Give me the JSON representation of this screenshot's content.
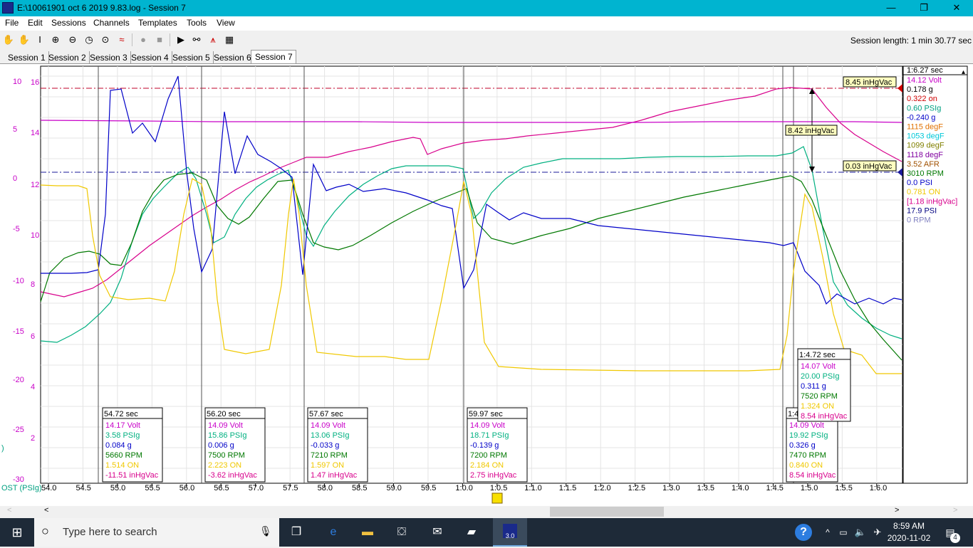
{
  "window": {
    "title": "E:\\10061901 oct 6 2019 9.83.log - Session 7",
    "minimize": "—",
    "restore": "❐",
    "close": "✕"
  },
  "menu": [
    "File",
    "Edit",
    "Sessions",
    "Channels",
    "Templates",
    "Tools",
    "View"
  ],
  "session_length": "Session length:  1 min 30.77 sec",
  "tabs": [
    "Session 1",
    "Session 2",
    "Session 3",
    "Session 4",
    "Session 5",
    "Session 6",
    "Session 7"
  ],
  "active_tab": "Session 7",
  "colors": {
    "volt": "#c800c8",
    "psi_green": "#00b080",
    "g_blue": "#0000c8",
    "rpm_green": "#007800",
    "on_yellow": "#f0c800",
    "vac_magenta": "#d8008c",
    "red": "#d00000",
    "cyan": "#00c8d8",
    "olive": "#808000",
    "purple": "#8000a0",
    "brown": "#a05000",
    "grey": "#8080c0",
    "navy": "#000080"
  },
  "left_axes": {
    "outer_ticks": [
      "10",
      "5",
      "0",
      "-5",
      "-10",
      "-15",
      "-20",
      "-25",
      "-30"
    ],
    "inner_ticks": [
      "16",
      "14",
      "12",
      "10",
      "8",
      "6",
      "4",
      "2"
    ],
    "bottom_label": "OST (PSIg)",
    "partial_label": ")"
  },
  "x_ticks": [
    "54.0",
    "54.5",
    "55.0",
    "55.5",
    "56.0",
    "56.5",
    "57.0",
    "57.5",
    "58.0",
    "58.5",
    "59.0",
    "59.5",
    "1:0.0",
    "1:0.5",
    "1:1.0",
    "1:1.5",
    "1:2.0",
    "1:2.5",
    "1:3.0",
    "1:3.5",
    "1:4.0",
    "1:4.5",
    "1:5.0",
    "1:5.5",
    "1:6.0"
  ],
  "right_panel": {
    "time": "1:6.27 sec",
    "values": [
      {
        "text": "14.12 Volt",
        "color": "#c800c8"
      },
      {
        "text": "0.178 g",
        "color": "#000000"
      },
      {
        "text": "0.322 on",
        "color": "#d00000"
      },
      {
        "text": "0.60 PSIg",
        "color": "#00a080"
      },
      {
        "text": "-0.240 g",
        "color": "#0000c8"
      },
      {
        "text": "1115 degF",
        "color": "#e07000"
      },
      {
        "text": "1053 degF",
        "color": "#00c8d8"
      },
      {
        "text": "1099 degF",
        "color": "#808000"
      },
      {
        "text": "1118 degF",
        "color": "#8000a0"
      },
      {
        "text": "3.52 AFR",
        "color": "#a05000"
      },
      {
        "text": "3010 RPM",
        "color": "#007800"
      },
      {
        "text": "0.0 PSI",
        "color": "#0000c8"
      },
      {
        "text": "0.781 ON",
        "color": "#f0c800"
      },
      {
        "text": "[1.18 inHgVac]",
        "color": "#d8008c"
      },
      {
        "text": "17.9 PSI",
        "color": "#000080"
      },
      {
        "text": "0 RPM",
        "color": "#8080c0"
      }
    ]
  },
  "ref_lines": {
    "top_label": "8.45 inHgVac",
    "bottom_label": "0.03 inHgVac",
    "delta_label": "8.42 inHgVac"
  },
  "cursor_boxes": [
    {
      "time": "54.72 sec",
      "volt": "14.17 Volt",
      "psi": "3.58 PSIg",
      "g": "0.084 g",
      "rpm": "5660 RPM",
      "on": "1.514 ON",
      "vac": "-11.51 inHgVac"
    },
    {
      "time": "56.20 sec",
      "volt": "14.09 Volt",
      "psi": "15.86 PSIg",
      "g": "0.006 g",
      "rpm": "7500 RPM",
      "on": "2.223 ON",
      "vac": "-3.62 inHgVac"
    },
    {
      "time": "57.67 sec",
      "volt": "14.09 Volt",
      "psi": "13.06 PSIg",
      "g": "-0.033 g",
      "rpm": "7210 RPM",
      "on": "1.597 ON",
      "vac": "1.47 inHgVac"
    },
    {
      "time": "59.97 sec",
      "volt": "14.09 Volt",
      "psi": "18.71 PSIg",
      "g": "-0.139 g",
      "rpm": "7200 RPM",
      "on": "2.184 ON",
      "vac": "2.75 inHgVac"
    },
    {
      "time": "1:4",
      "volt": "14.09 Volt",
      "psi": "19.92 PSIg",
      "g": "0.326 g",
      "rpm": "7470 RPM",
      "on": "0.840 ON",
      "vac": "8.54 inHgVac"
    },
    {
      "time": "1:4.72 sec",
      "volt": "14.07 Volt",
      "psi": "20.00 PSIg",
      "g": "0.311 g",
      "rpm": "7520 RPM",
      "on": "1.324 ON",
      "vac": "8.54 inHgVac"
    }
  ],
  "taskbar": {
    "search_placeholder": "Type here to search",
    "time": "8:59 AM",
    "date": "2020-11-02",
    "notif_count": "4",
    "app_badge": "3.0"
  }
}
